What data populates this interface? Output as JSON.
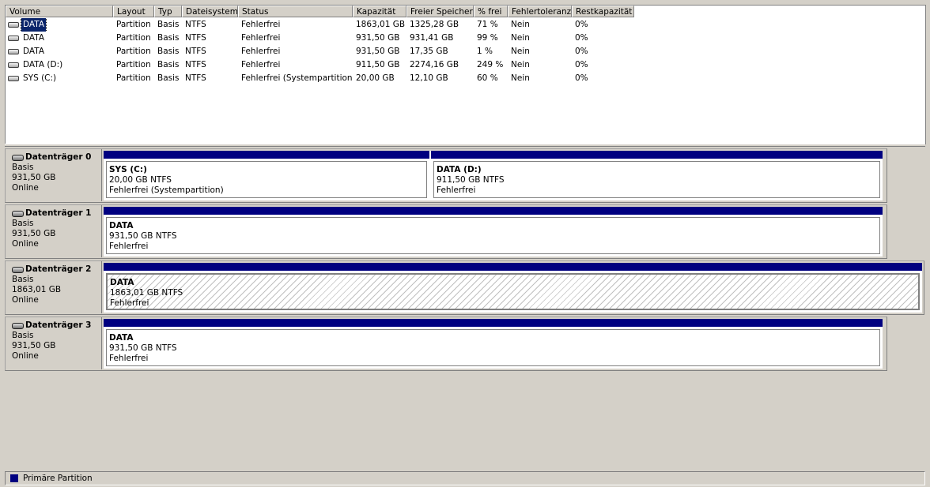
{
  "colors": {
    "primary_partition": "#000080",
    "selection": "#0a246a"
  },
  "volume_list": {
    "columns": [
      "Volume",
      "Layout",
      "Typ",
      "Dateisystem",
      "Status",
      "Kapazität",
      "Freier Speicher",
      "% frei",
      "Fehlertoleranz",
      "Restkapazität"
    ],
    "rows": [
      {
        "volume": "DATA",
        "layout": "Partition",
        "typ": "Basis",
        "fs": "NTFS",
        "status": "Fehlerfrei",
        "capacity": "1863,01 GB",
        "free": "1325,28 GB",
        "pct": "71 %",
        "fault": "Nein",
        "rest": "0%",
        "icon": "volume-icon",
        "selected": true
      },
      {
        "volume": "DATA",
        "layout": "Partition",
        "typ": "Basis",
        "fs": "NTFS",
        "status": "Fehlerfrei",
        "capacity": "931,50 GB",
        "free": "931,41 GB",
        "pct": "99 %",
        "fault": "Nein",
        "rest": "0%",
        "icon": "volume-icon",
        "selected": false
      },
      {
        "volume": "DATA",
        "layout": "Partition",
        "typ": "Basis",
        "fs": "NTFS",
        "status": "Fehlerfrei",
        "capacity": "931,50 GB",
        "free": "17,35 GB",
        "pct": "1 %",
        "fault": "Nein",
        "rest": "0%",
        "icon": "volume-icon",
        "selected": false
      },
      {
        "volume": "DATA (D:)",
        "layout": "Partition",
        "typ": "Basis",
        "fs": "NTFS",
        "status": "Fehlerfrei",
        "capacity": "911,50 GB",
        "free": "2274,16 GB",
        "pct": "249 %",
        "fault": "Nein",
        "rest": "0%",
        "icon": "volume-icon",
        "selected": false
      },
      {
        "volume": "SYS (C:)",
        "layout": "Partition",
        "typ": "Basis",
        "fs": "NTFS",
        "status": "Fehlerfrei (Systempartition)",
        "capacity": "20,00 GB",
        "free": "12,10 GB",
        "pct": "60 %",
        "fault": "Nein",
        "rest": "0%",
        "icon": "volume-icon",
        "selected": false
      }
    ]
  },
  "disks": [
    {
      "name": "Datenträger 0",
      "type": "Basis",
      "size": "931,50 GB",
      "state": "Online",
      "icon": "disk-icon",
      "partitions": [
        {
          "name": "SYS  (C:)",
          "size_fs": "20,00 GB NTFS",
          "status": "Fehlerfrei (Systempartition)",
          "selected": false
        },
        {
          "name": "DATA  (D:)",
          "size_fs": "911,50 GB NTFS",
          "status": "Fehlerfrei",
          "selected": false
        }
      ]
    },
    {
      "name": "Datenträger 1",
      "type": "Basis",
      "size": "931,50 GB",
      "state": "Online",
      "icon": "disk-icon",
      "partitions": [
        {
          "name": "DATA",
          "size_fs": "931,50 GB NTFS",
          "status": "Fehlerfrei",
          "selected": false
        }
      ]
    },
    {
      "name": "Datenträger 2",
      "type": "Basis",
      "size": "1863,01 GB",
      "state": "Online",
      "icon": "disk-icon",
      "partitions": [
        {
          "name": "DATA",
          "size_fs": "1863,01 GB NTFS",
          "status": "Fehlerfrei",
          "selected": true
        }
      ]
    },
    {
      "name": "Datenträger 3",
      "type": "Basis",
      "size": "931,50 GB",
      "state": "Online",
      "icon": "disk-icon",
      "partitions": [
        {
          "name": "DATA",
          "size_fs": "931,50 GB NTFS",
          "status": "Fehlerfrei",
          "selected": false
        }
      ]
    }
  ],
  "legend": {
    "label": "Primäre Partition"
  }
}
